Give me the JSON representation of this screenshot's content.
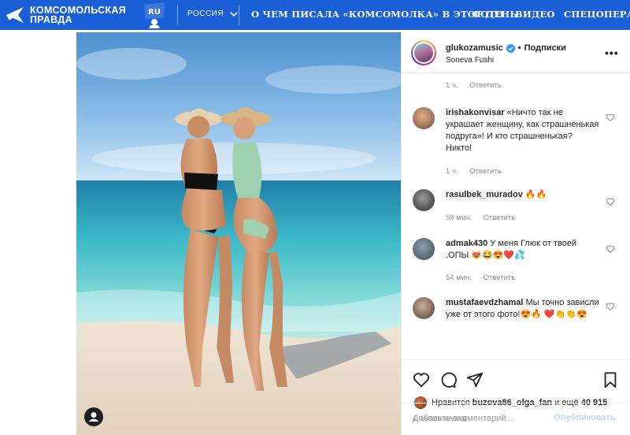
{
  "colors": {
    "brand_blue": "#1a5fd6",
    "instagram_text": "#262626",
    "muted": "#8e8e8e",
    "publish_disabled": "#b3dbff"
  },
  "header": {
    "logo_line1": "КОМСОМОЛЬСКАЯ",
    "logo_line2": "ПРАВДА",
    "logo_icon": "kp-arrow-logo",
    "badge_icon": "ru-site-badge",
    "badge_text": "RU",
    "region_label": "РОССИЯ",
    "nav": [
      "О ЧЕМ ПИСАЛА «КОМСОМОЛКА» В ЭТОТ ДЕНЬ",
      "ФОТО",
      "ВИДЕО",
      "СПЕЦОПЕРАЦИЯ"
    ]
  },
  "post": {
    "username": "glukozamusic",
    "follow_separator": "•",
    "follow_label": "Подписки",
    "location": "Soneva Fushi",
    "top_meta": {
      "time": "1 ч.",
      "reply": "Ответить"
    },
    "comments": [
      {
        "user": "irishakonvisar",
        "text": "«Ничто так не украшает женщину, как страшненькая подруга»! И кто страшненькая? Никто!",
        "time": "1 ч.",
        "reply": "Ответить"
      },
      {
        "user": "rasulbek_muradov",
        "text": "🔥🔥",
        "time": "59 мин.",
        "reply": "Ответить"
      },
      {
        "user": "admak430",
        "text": "У меня Глюк от твоей .ОПЫ 😻😂😍❤️💦",
        "time": "54 мин.",
        "reply": "Ответить"
      },
      {
        "user": "mustafaevdzhamal",
        "text": "Мы точно зависли уже от этого фото!😍🔥 ❤️👏👏😍",
        "time": "",
        "reply": ""
      }
    ],
    "likes_prefix": "Нравится",
    "likes_user": "buzova86_olga_fan",
    "likes_suffix": "и ещё",
    "likes_count": "40 915",
    "time_ago": "4 ЧАСОВ НАЗАД",
    "add_comment_placeholder": "Добавьте комментарий...",
    "publish_label": "Опубликовать"
  }
}
